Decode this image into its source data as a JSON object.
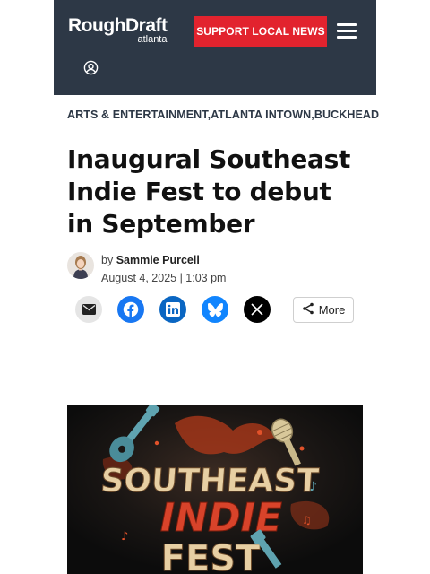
{
  "header": {
    "logo_main": "RoughDraft",
    "logo_sub": "atlanta",
    "support_label": "SUPPORT LOCAL NEWS",
    "menu_icon": "hamburger-menu-icon",
    "account_icon": "user-account-icon",
    "background": "#2d3846",
    "support_color": "#e2232e"
  },
  "article": {
    "categories": [
      "ARTS & ENTERTAINMENT",
      "ATLANTA INTOWN",
      "BUCKHEAD"
    ],
    "category_sep": ",",
    "title": "Inaugural Southeast Indie Fest to debut in September",
    "by_prefix": "by",
    "author": "Sammie Purcell",
    "date": "August 4, 2025 | 1:03 pm"
  },
  "share": {
    "buttons": [
      {
        "name": "email",
        "icon": "email-icon",
        "color": "#e5e5e5"
      },
      {
        "name": "facebook",
        "icon": "facebook-icon",
        "color": "#1877f2"
      },
      {
        "name": "linkedin",
        "icon": "linkedin-icon",
        "color": "#0a66c2"
      },
      {
        "name": "bluesky",
        "icon": "bluesky-icon",
        "color": "#1185fe"
      },
      {
        "name": "x",
        "icon": "x-icon",
        "color": "#000000"
      }
    ],
    "more_label": "More"
  },
  "hero": {
    "poster_line1": "SOUTHEAST",
    "poster_line2": "INDIE",
    "poster_line3": "FEST"
  }
}
